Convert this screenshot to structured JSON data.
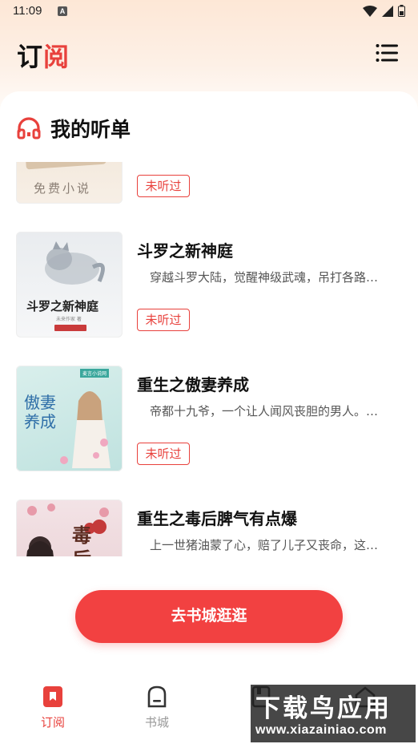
{
  "status_bar": {
    "time": "11:09",
    "notification_letter": "A"
  },
  "header": {
    "title_part1": "订",
    "title_part2": "阅"
  },
  "section": {
    "title": "我的听单"
  },
  "books": [
    {
      "title": "",
      "desc": "",
      "cover_text": "免费小说",
      "badge": "未听过"
    },
    {
      "title": "斗罗之新神庭",
      "desc": "穿越斗罗大陆，觉醒神级武魂，吊打各路…",
      "cover_text": "斗罗之新神庭",
      "cover_author": "未来作家 著",
      "badge": "未听过"
    },
    {
      "title": "重生之傲妻养成",
      "desc": "帝都十九爷，一个让人闻风丧胆的男人。…",
      "cover_text": "傲妻养成",
      "cover_badge": "麦言小说网",
      "badge": "未听过"
    },
    {
      "title": "重生之毒后脾气有点爆",
      "desc": "上一世猪油蒙了心，赔了儿子又丧命，这…",
      "cover_text": "毒后",
      "badge": ""
    }
  ],
  "cta": {
    "label": "去书城逛逛"
  },
  "nav": {
    "items": [
      {
        "label": "订阅",
        "icon": "bookmark-icon",
        "active": true
      },
      {
        "label": "书城",
        "icon": "bookstore-icon",
        "active": false
      },
      {
        "label": "",
        "icon": "bookshelf-icon",
        "active": false
      },
      {
        "label": "",
        "icon": "profile-icon",
        "active": false
      }
    ]
  },
  "watermark": {
    "text": "下载鸟应用",
    "url": "www.xiazainiao.com"
  },
  "colors": {
    "accent": "#e8413c",
    "cta": "#f24141"
  }
}
